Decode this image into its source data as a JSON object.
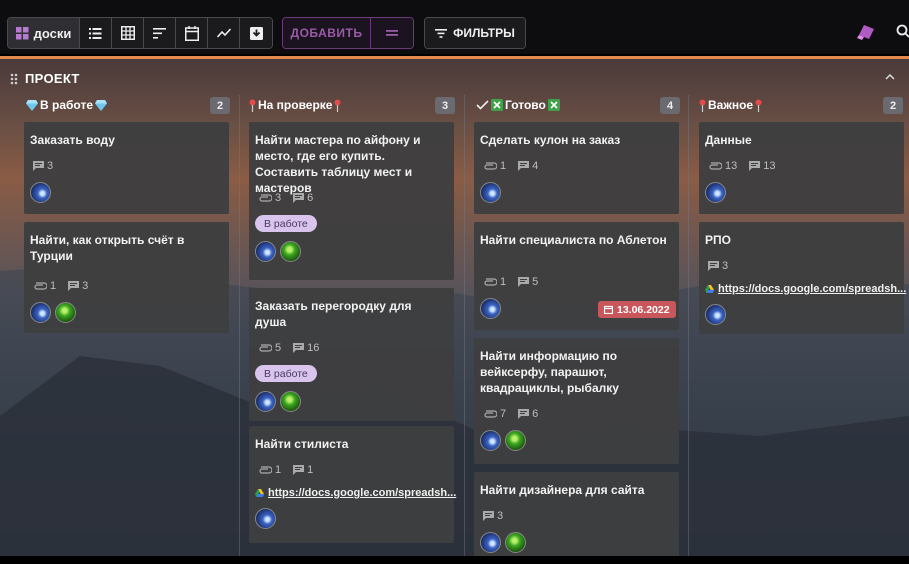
{
  "toolbar": {
    "boards_label": "доски",
    "add_label": "ДОБАВИТЬ",
    "filters_label": "ФИЛЬТРЫ",
    "accent": "#9a5aa8"
  },
  "board": {
    "title": "ПРОЕКТ",
    "accent": "#e58a4f"
  },
  "columns": [
    {
      "title": "В работе",
      "count": "2",
      "cards": [
        {
          "title": "Заказать воду",
          "comments": "3"
        },
        {
          "title": "Найти, как открыть счёт в Турции",
          "attachments": "1",
          "comments": "3"
        }
      ]
    },
    {
      "title": "На проверке",
      "count": "3",
      "cards": [
        {
          "title": "Найти мастера по айфону и место, где его купить. Составить таблицу мест и мастеров",
          "attachments": "3",
          "comments": "6",
          "badge": "В работе"
        },
        {
          "title": "Заказать перегородку для душа",
          "attachments": "5",
          "comments": "16",
          "badge": "В работе"
        },
        {
          "title": "Найти стилиста",
          "attachments": "1",
          "comments": "1",
          "link": "https://docs.google.com/spreadsh..."
        }
      ]
    },
    {
      "title": "Готово",
      "count": "4",
      "cards": [
        {
          "title": "Сделать кулон на заказ",
          "attachments": "1",
          "comments": "4"
        },
        {
          "title": "Найти специалиста по Аблетон",
          "attachments": "1",
          "comments": "5",
          "date": "13.06.2022"
        },
        {
          "title": "Найти информацию по вейксерфу, парашют, квадрациклы, рыбалку",
          "attachments": "7",
          "comments": "6"
        },
        {
          "title": "Найти дизайнера для сайта",
          "comments": "3"
        }
      ]
    },
    {
      "title": "Важное",
      "count": "2",
      "cards": [
        {
          "title": "Данные",
          "attachments": "13",
          "comments": "13"
        },
        {
          "title": "РПО",
          "comments": "3",
          "link": "https://docs.google.com/spreadsh..."
        }
      ]
    }
  ],
  "colors": {
    "badge_bg": "#d8c4ec",
    "date_bg": "#c8565a",
    "card_bg": "#3e3e40"
  }
}
